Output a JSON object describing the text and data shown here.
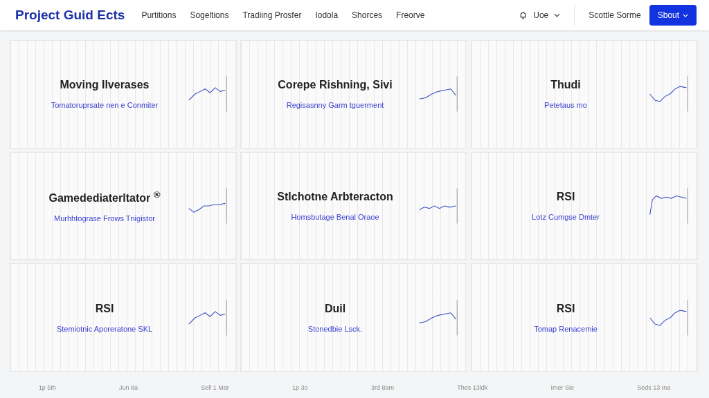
{
  "header": {
    "logo": "Project Guid Ects",
    "nav": [
      "Purtitions",
      "Sogeltions",
      "Tradiing Prosfer",
      "Iodola",
      "Shorces",
      "Freorve"
    ],
    "user": "Uoe",
    "link": "Scottle Sorme",
    "button": "Sbout"
  },
  "cards": [
    {
      "title": "Moving Ilverases",
      "subtitle": "Tomatoruprsate nen e Conmiter"
    },
    {
      "title": "Corepe Rishning, Sivi",
      "subtitle": "Regisasnny Garm tguerment"
    },
    {
      "title": "Thudi",
      "subtitle": "Petetaus mo"
    },
    {
      "title": "Gamedediaterltator $^{®}$",
      "subtitle": "Murhhtograse Frows Tnigistor"
    },
    {
      "title": "Stlchotne Arbteracton",
      "subtitle": "Homsbutage Benal Oraoe"
    },
    {
      "title": "RSI",
      "subtitle": "Lotz Cumgse Dmter"
    },
    {
      "title": "RSI",
      "subtitle": "Stemiotnic Aporeratone SKL"
    },
    {
      "title": "Duil",
      "subtitle": "Stonedbie Lsck."
    },
    {
      "title": "RSI",
      "subtitle": "Tomap Renacemie"
    }
  ],
  "axis_labels": [
    "1p 5th",
    "Jun 8a",
    "Sell 1 Mar",
    "1p 3o",
    "3rd 8am",
    "Thes 13ldk",
    "Imer Sie",
    "Seds 13 Ina"
  ]
}
